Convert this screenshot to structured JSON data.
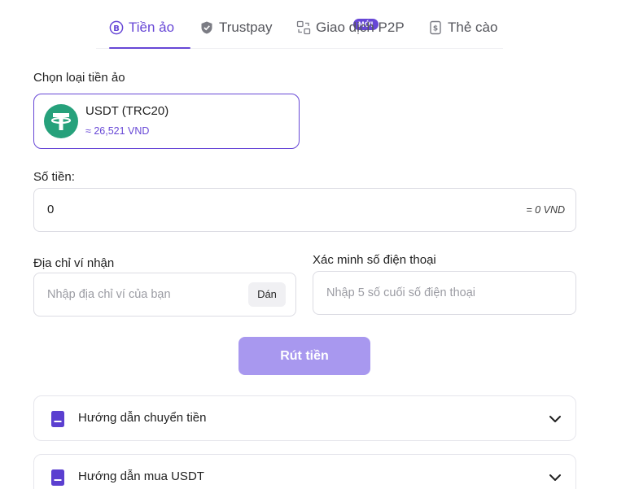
{
  "tabs": [
    {
      "label": "Tiền ảo",
      "active": true,
      "icon": "bitcoin-icon"
    },
    {
      "label": "Trustpay",
      "active": false,
      "icon": "shield-check-icon",
      "badge": "MỚI"
    },
    {
      "label": "Giao dịch P2P",
      "active": false,
      "icon": "p2p-exchange-icon"
    },
    {
      "label": "Thẻ cào",
      "active": false,
      "icon": "scratch-card-icon"
    }
  ],
  "coin_section": {
    "label": "Chọn loại tiền ảo",
    "coin_name": "USDT (TRC20)",
    "coin_rate": "≈ 26,521 VND",
    "logo_color": "#26A17B"
  },
  "amount": {
    "label": "Số tiền:",
    "value": "0",
    "converted": "= 0 VND"
  },
  "wallet": {
    "label": "Địa chỉ ví nhận",
    "placeholder": "Nhập địa chỉ ví của bạn",
    "paste_label": "Dán"
  },
  "phone": {
    "label": "Xác minh số điện thoại",
    "placeholder": "Nhập 5 số cuối số điện thoại"
  },
  "submit_label": "Rút tiền",
  "guides": [
    {
      "title": "Hướng dẫn chuyển tiền"
    },
    {
      "title": "Hướng dẫn mua USDT"
    }
  ],
  "colors": {
    "accent": "#6747D6",
    "button_disabled": "#A898EF",
    "tether": "#26A17B"
  }
}
